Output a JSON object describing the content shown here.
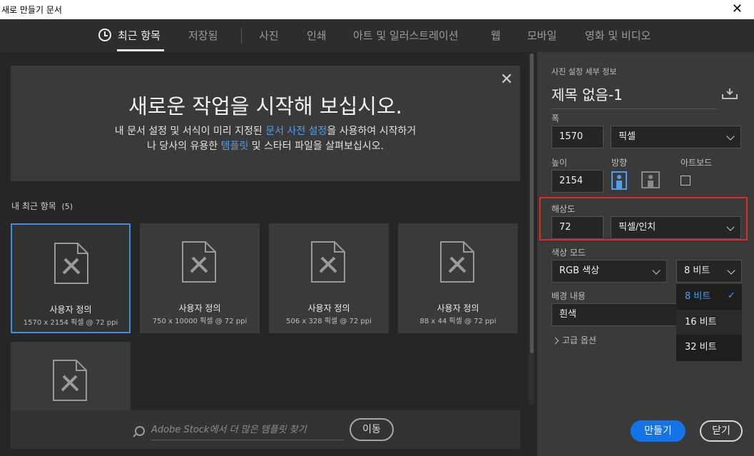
{
  "window": {
    "title": "새로 만들기 문서",
    "close": "✕"
  },
  "tabs": [
    "최근 항목",
    "저장됨",
    "사진",
    "인쇄",
    "아트 및 일러스트레이션",
    "웹",
    "모바일",
    "영화 및 비디오"
  ],
  "hero": {
    "close": "✕",
    "title": "새로운 작업을 시작해 보십시오.",
    "line1_a": "내 문서 설정 및 서식이 미리 지정된 ",
    "line1_link": "문서 사전 설정",
    "line1_b": "을 사용하여 시작하거",
    "line2_a": "나 당사의 유용한 ",
    "line2_link": "템플릿",
    "line2_b": " 및 스타터 파일을 살펴보십시오."
  },
  "recent": {
    "heading": "내 최근 항목",
    "count": "(5)",
    "items": [
      {
        "name": "사용자 정의",
        "meta": "1570 x 2154 픽셀 @ 72 ppi"
      },
      {
        "name": "사용자 정의",
        "meta": "750 x 10000 픽셀 @ 72 ppi"
      },
      {
        "name": "사용자 정의",
        "meta": "506 x 328 픽셀 @ 72 ppi"
      },
      {
        "name": "사용자 정의",
        "meta": "88 x 44 픽셀 @ 72 ppi"
      },
      {
        "name": "",
        "meta": ""
      }
    ]
  },
  "stock": {
    "placeholder": "Adobe Stock에서 더 많은 템플릿 찾기",
    "button": "이동"
  },
  "preset": {
    "heading": "사진 설정 세부 정보",
    "doc_name": "제목 없음-1",
    "width_label": "폭",
    "width_value": "1570",
    "width_unit": "픽셀",
    "height_label": "높이",
    "height_value": "2154",
    "orientation_label": "방향",
    "artboard_label": "아트보드",
    "resolution_label": "해상도",
    "resolution_value": "72",
    "resolution_unit": "픽셀/인치",
    "color_mode_label": "색상 모드",
    "color_mode_value": "RGB 색상",
    "bit_depth_value": "8 비트",
    "bit_options": [
      "8 비트",
      "16 비트",
      "32 비트"
    ],
    "bit_check": "✓",
    "background_label": "배경 내용",
    "background_value": "흰색",
    "advanced": "고급 옵션",
    "create": "만들기",
    "close": "닫기"
  }
}
